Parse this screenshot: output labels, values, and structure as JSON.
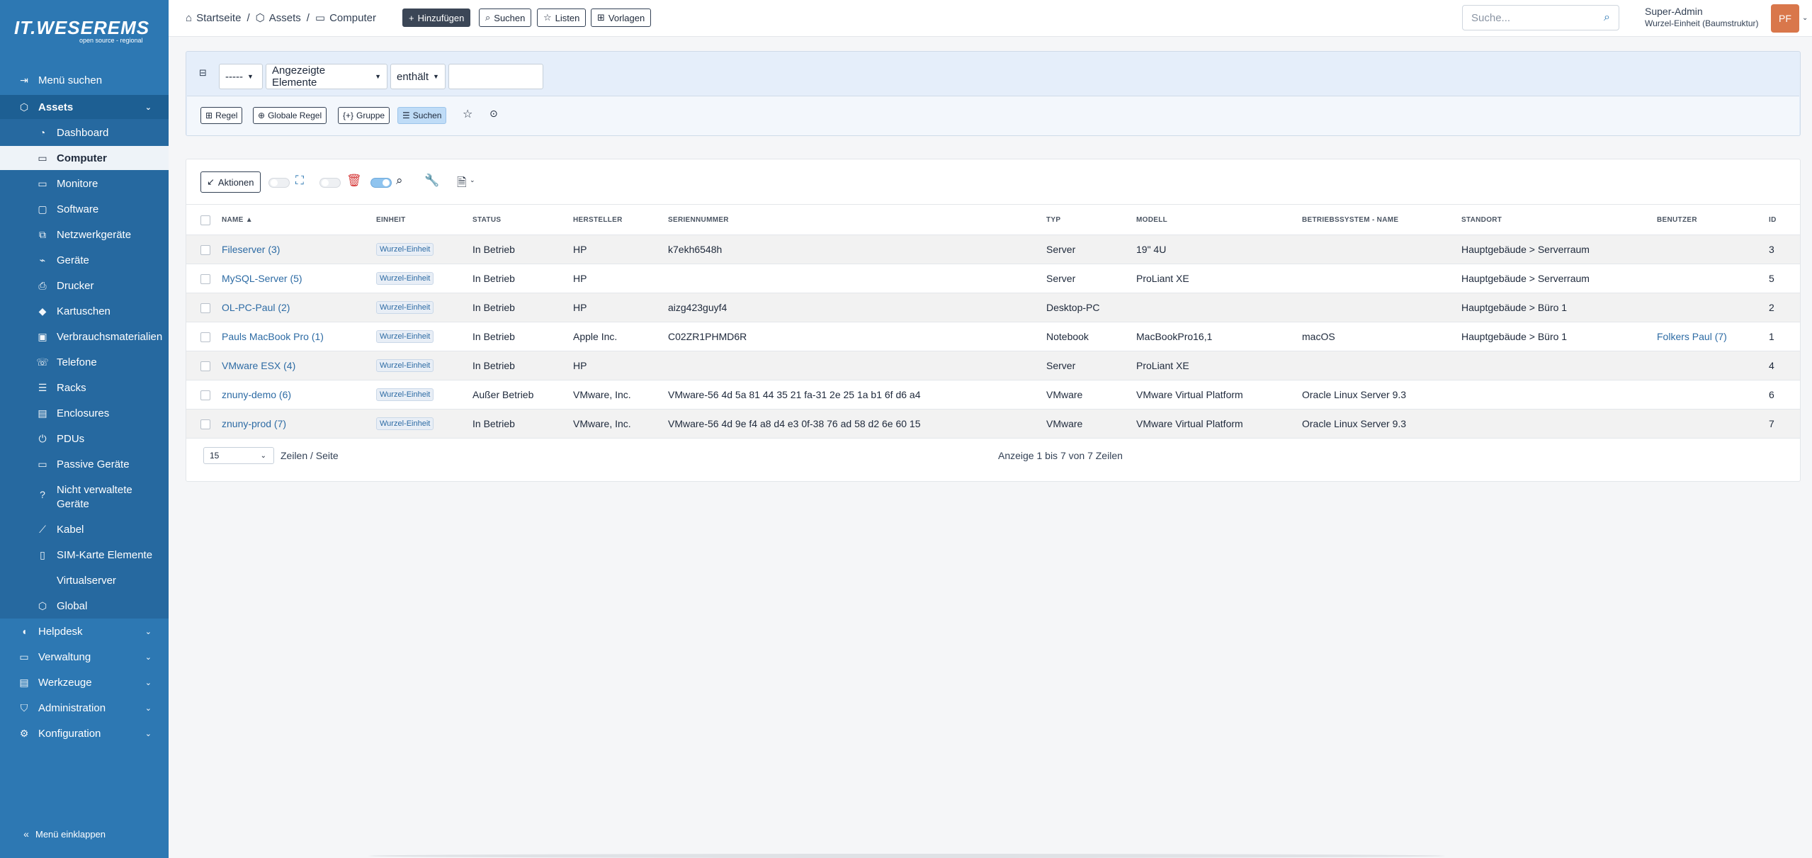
{
  "app": {
    "logo_text_1": "IT.",
    "logo_text_2": "WESER",
    "logo_text_3": "EMS",
    "logo_sub": "open source - regional"
  },
  "sidebar": {
    "search_menu": "Menü suchen",
    "sections": [
      {
        "label": "Assets",
        "icon": "cube-icon"
      },
      {
        "label": "Helpdesk",
        "icon": "headset-icon"
      },
      {
        "label": "Verwaltung",
        "icon": "wallet-icon"
      },
      {
        "label": "Werkzeuge",
        "icon": "briefcase-icon"
      },
      {
        "label": "Administration",
        "icon": "shield-icon"
      },
      {
        "label": "Konfiguration",
        "icon": "cog-icon"
      }
    ],
    "items": [
      {
        "label": "Dashboard",
        "icon": "gauge-icon"
      },
      {
        "label": "Computer",
        "icon": "laptop-icon"
      },
      {
        "label": "Monitore",
        "icon": "monitor-icon"
      },
      {
        "label": "Software",
        "icon": "software-icon"
      },
      {
        "label": "Netzwerkgeräte",
        "icon": "network-icon"
      },
      {
        "label": "Geräte",
        "icon": "devices-icon"
      },
      {
        "label": "Drucker",
        "icon": "printer-icon"
      },
      {
        "label": "Kartuschen",
        "icon": "droplet-icon"
      },
      {
        "label": "Verbrauchsmaterialien",
        "icon": "package-icon"
      },
      {
        "label": "Telefone",
        "icon": "phone-icon"
      },
      {
        "label": "Racks",
        "icon": "server-icon"
      },
      {
        "label": "Enclosures",
        "icon": "enclosure-icon"
      },
      {
        "label": "PDUs",
        "icon": "plug-icon"
      },
      {
        "label": "Passive Geräte",
        "icon": "box-icon"
      },
      {
        "label": "Nicht verwaltete",
        "label2": "Geräte",
        "icon": "question-icon"
      },
      {
        "label": "Kabel",
        "icon": "cable-icon"
      },
      {
        "label": "SIM-Karte Elemente",
        "icon": "sim-icon"
      },
      {
        "label": "Virtualserver",
        "icon": ""
      },
      {
        "label": "Global",
        "icon": "global-icon"
      }
    ],
    "collapse": "Menü einklappen"
  },
  "breadcrumb": [
    "Startseite",
    "Assets",
    "Computer"
  ],
  "toolbar": {
    "add": "Hinzufügen",
    "search": "Suchen",
    "lists": "Listen",
    "templates": "Vorlagen"
  },
  "global_search": {
    "placeholder": "Suche..."
  },
  "user": {
    "name": "Super-Admin",
    "entity": "Wurzel-Einheit (Baumstruktur)",
    "initials": "PF"
  },
  "filter": {
    "field1": "-----",
    "field2": "Angezeigte Elemente",
    "operator": "enthält",
    "value": "",
    "btn_rule": "Regel",
    "btn_global_rule": "Globale Regel",
    "btn_group": "Gruppe",
    "btn_search": "Suchen"
  },
  "list": {
    "actions": "Aktionen",
    "columns": [
      "NAME",
      "EINHEIT",
      "STATUS",
      "HERSTELLER",
      "SERIENNUMMER",
      "TYP",
      "MODELL",
      "BETRIEBSSYSTEM - NAME",
      "STANDORT",
      "BENUTZER",
      "ID"
    ],
    "rows": [
      {
        "name": "Fileserver (3)",
        "entity": "Wurzel-Einheit",
        "status": "In Betrieb",
        "manufacturer": "HP",
        "serial": "k7ekh6548h",
        "type": "Server",
        "model": "19\" 4U",
        "os": "",
        "location": "Hauptgebäude > Serverraum",
        "user": "",
        "id": "3"
      },
      {
        "name": "MySQL-Server (5)",
        "entity": "Wurzel-Einheit",
        "status": "In Betrieb",
        "manufacturer": "HP",
        "serial": "",
        "type": "Server",
        "model": "ProLiant XE",
        "os": "",
        "location": "Hauptgebäude > Serverraum",
        "user": "",
        "id": "5"
      },
      {
        "name": "OL-PC-Paul (2)",
        "entity": "Wurzel-Einheit",
        "status": "In Betrieb",
        "manufacturer": "HP",
        "serial": "aizg423guyf4",
        "type": "Desktop-PC",
        "model": "",
        "os": "",
        "location": "Hauptgebäude > Büro 1",
        "user": "",
        "id": "2"
      },
      {
        "name": "Pauls MacBook Pro (1)",
        "entity": "Wurzel-Einheit",
        "status": "In Betrieb",
        "manufacturer": "Apple Inc.",
        "serial": "C02ZR1PHMD6R",
        "type": "Notebook",
        "model": "MacBookPro16,1",
        "os": "macOS",
        "location": "Hauptgebäude > Büro 1",
        "user": "Folkers Paul (7)",
        "id": "1"
      },
      {
        "name": "VMware ESX (4)",
        "entity": "Wurzel-Einheit",
        "status": "In Betrieb",
        "manufacturer": "HP",
        "serial": "",
        "type": "Server",
        "model": "ProLiant XE",
        "os": "",
        "location": "",
        "user": "",
        "id": "4"
      },
      {
        "name": "znuny-demo (6)",
        "entity": "Wurzel-Einheit",
        "status": "Außer Betrieb",
        "manufacturer": "VMware, Inc.",
        "serial": "VMware-56 4d 5a 81 44 35 21 fa-31 2e 25 1a b1 6f d6 a4",
        "type": "VMware",
        "model": "VMware Virtual Platform",
        "os": "Oracle Linux Server 9.3",
        "location": "",
        "user": "",
        "id": "6"
      },
      {
        "name": "znuny-prod (7)",
        "entity": "Wurzel-Einheit",
        "status": "In Betrieb",
        "manufacturer": "VMware, Inc.",
        "serial": "VMware-56 4d 9e f4 a8 d4 e3 0f-38 76 ad 58 d2 6e 60 15",
        "type": "VMware",
        "model": "VMware Virtual Platform",
        "os": "Oracle Linux Server 9.3",
        "location": "",
        "user": "",
        "id": "7"
      }
    ],
    "page_size": "15",
    "page_size_label": "Zeilen / Seite",
    "summary": "Anzeige 1 bis 7 von 7 Zeilen"
  }
}
